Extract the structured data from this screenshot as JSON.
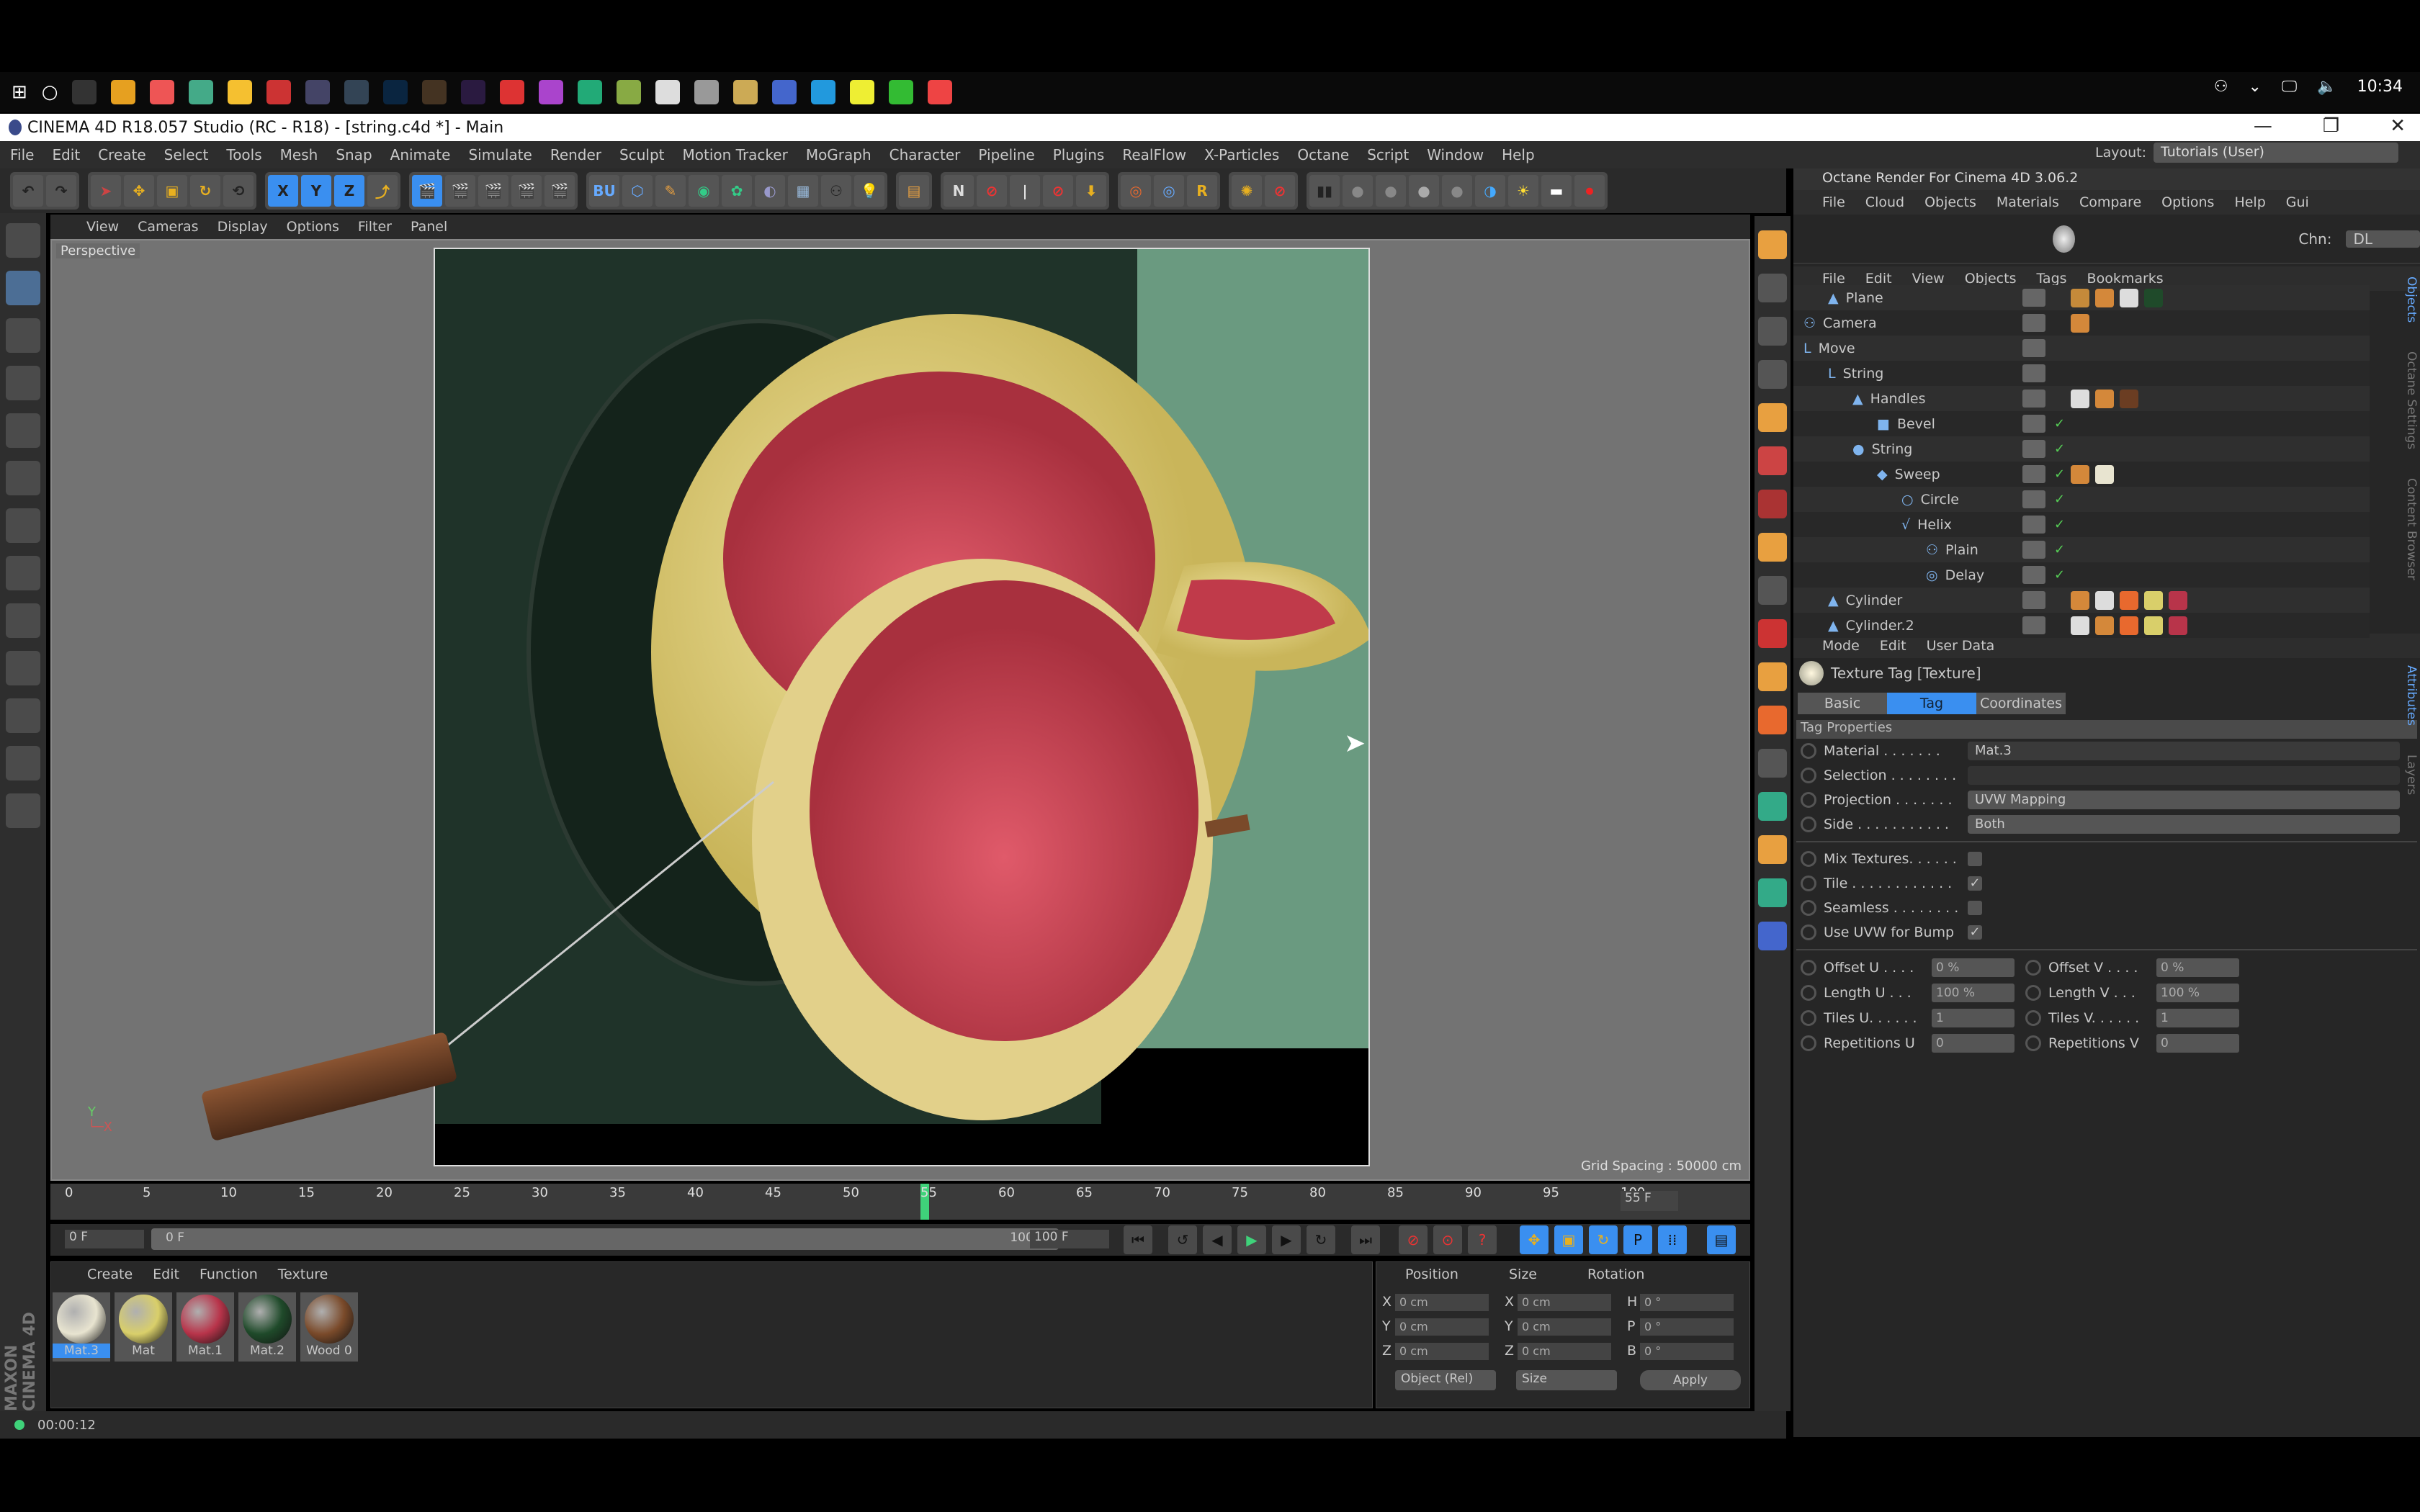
{
  "os": {
    "clock": "10:34"
  },
  "window": {
    "title": "CINEMA 4D R18.057 Studio (RC - R18) - [string.c4d *] - Main",
    "minimize": "—",
    "restore": "❐",
    "close": "✕"
  },
  "menubar": [
    "File",
    "Edit",
    "Create",
    "Select",
    "Tools",
    "Mesh",
    "Snap",
    "Animate",
    "Simulate",
    "Render",
    "Sculpt",
    "Motion Tracker",
    "MoGraph",
    "Character",
    "Pipeline",
    "Plugins",
    "RealFlow",
    "X-Particles",
    "Octane",
    "Script",
    "Window",
    "Help"
  ],
  "layout": {
    "label": "Layout:",
    "value": "Tutorials (User)"
  },
  "toolbar": {
    "x": "X",
    "y": "Y",
    "z": "Z"
  },
  "viewport": {
    "menu": [
      "View",
      "Cameras",
      "Display",
      "Options",
      "Filter",
      "Panel"
    ],
    "label": "Perspective",
    "grid_spacing": "Grid Spacing : 50000 cm"
  },
  "octane": {
    "title": "Octane Render For Cinema 4D 3.06.2",
    "menu": [
      "File",
      "Cloud",
      "Objects",
      "Materials",
      "Compare",
      "Options",
      "Help",
      "Gui"
    ],
    "chn_label": "Chn:",
    "chn_value": "DL"
  },
  "objects": {
    "menu": [
      "File",
      "Edit",
      "View",
      "Objects",
      "Tags",
      "Bookmarks"
    ],
    "items": [
      {
        "name": "Plane",
        "indent": 1,
        "icon": "▲",
        "check": false,
        "tags": [
          "#c58a3a",
          "#d4883a",
          "#ddd",
          "#1f4a2a"
        ]
      },
      {
        "name": "Camera",
        "indent": 0,
        "icon": "⚇",
        "check": false,
        "tags": [
          "#d4883a"
        ]
      },
      {
        "name": "Move",
        "indent": 0,
        "icon": "L",
        "check": false,
        "tags": []
      },
      {
        "name": "String",
        "indent": 1,
        "icon": "L",
        "check": false,
        "tags": []
      },
      {
        "name": "Handles",
        "indent": 2,
        "icon": "▲",
        "check": false,
        "tags": [
          "#ddd",
          "#d4883a",
          "#6b3d22"
        ]
      },
      {
        "name": "Bevel",
        "indent": 3,
        "icon": "■",
        "check": true,
        "tags": []
      },
      {
        "name": "String",
        "indent": 2,
        "icon": "●",
        "check": true,
        "tags": []
      },
      {
        "name": "Sweep",
        "indent": 3,
        "icon": "◆",
        "check": true,
        "tags": [
          "#d4883a",
          "#e8e4d0"
        ]
      },
      {
        "name": "Circle",
        "indent": 4,
        "icon": "○",
        "check": true,
        "tags": []
      },
      {
        "name": "Helix",
        "indent": 4,
        "icon": "√",
        "check": true,
        "tags": []
      },
      {
        "name": "Plain",
        "indent": 5,
        "icon": "⚇",
        "check": true,
        "tags": []
      },
      {
        "name": "Delay",
        "indent": 5,
        "icon": "◎",
        "check": true,
        "tags": []
      },
      {
        "name": "Cylinder",
        "indent": 1,
        "icon": "▲",
        "check": false,
        "tags": [
          "#d4883a",
          "#ddd",
          "#e8692e",
          "#d9cf6a",
          "#b8344a"
        ]
      },
      {
        "name": "Cylinder.2",
        "indent": 1,
        "icon": "▲",
        "check": false,
        "tags": [
          "#ddd",
          "#d4883a",
          "#e8692e",
          "#d9cf6a",
          "#b8344a"
        ]
      }
    ]
  },
  "side_tabs": {
    "objects": "Objects",
    "octane_settings": "Octane Settings",
    "content_browser": "Content Browser",
    "attributes": "Attributes",
    "layers": "Layers"
  },
  "attributes": {
    "menu": [
      "Mode",
      "Edit",
      "User Data"
    ],
    "title": "Texture Tag [Texture]",
    "tabs": [
      "Basic",
      "Tag",
      "Coordinates"
    ],
    "active_tab": "Tag",
    "section": "Tag Properties",
    "material_label": "Material . . . . . . .",
    "material": "Mat.3",
    "selection_label": "Selection . . . . . . . .",
    "selection": "",
    "projection_label": "Projection . . . . . . .",
    "projection": "UVW Mapping",
    "side_label": "Side . . . . . . . . . . .",
    "side": "Both",
    "mix_label": "Mix Textures. . . . . .",
    "mix": false,
    "tile_label": "Tile . . . . . . . . . . . .",
    "tile": true,
    "seamless_label": "Seamless . . . . . . . .",
    "seamless": false,
    "uvw_label": "Use UVW for Bump",
    "uvw": true,
    "offset_u_label": "Offset U . . . .",
    "offset_u": "0 %",
    "offset_v_label": "Offset V . . . .",
    "offset_v": "0 %",
    "length_u_label": "Length U . . .",
    "length_u": "100 %",
    "length_v_label": "Length V . . .",
    "length_v": "100 %",
    "tiles_u_label": "Tiles U. . . . . .",
    "tiles_u": "1",
    "tiles_v_label": "Tiles V. . . . . .",
    "tiles_v": "1",
    "rep_u_label": "Repetitions U",
    "rep_u": "0",
    "rep_v_label": "Repetitions V",
    "rep_v": "0"
  },
  "timeline": {
    "ticks": [
      "0",
      "5",
      "10",
      "15",
      "20",
      "25",
      "30",
      "35",
      "40",
      "45",
      "50",
      "55",
      "60",
      "65",
      "70",
      "75",
      "80",
      "85",
      "90",
      "95",
      "100"
    ],
    "current_frame": 55,
    "current": "55 F",
    "start": "0 F",
    "range_start": "0 F",
    "range_end": "100 F",
    "end": "100 F"
  },
  "materials": {
    "menu": [
      "Create",
      "Edit",
      "Function",
      "Texture"
    ],
    "items": [
      {
        "name": "Mat.3",
        "color": "#e8e4d0",
        "selected": true
      },
      {
        "name": "Mat",
        "color": "#d9cf6a"
      },
      {
        "name": "Mat.1",
        "color": "#b8344a"
      },
      {
        "name": "Mat.2",
        "color": "#1f4a2a"
      },
      {
        "name": "Wood 0",
        "color": "#7a4a2a"
      }
    ]
  },
  "coords": {
    "headers": [
      "Position",
      "Size",
      "Rotation"
    ],
    "pos": [
      "0 cm",
      "0 cm",
      "0 cm"
    ],
    "size": [
      "0 cm",
      "0 cm",
      "0 cm"
    ],
    "rot": [
      "0 °",
      "0 °",
      "0 °"
    ],
    "pos_axes": [
      "X",
      "Y",
      "Z"
    ],
    "rot_axes": [
      "H",
      "P",
      "B"
    ],
    "mode": "Object (Rel)",
    "size_mode": "Size",
    "apply": "Apply"
  },
  "status": {
    "time": "00:00:12"
  },
  "brand": "MAXON CINEMA 4D"
}
